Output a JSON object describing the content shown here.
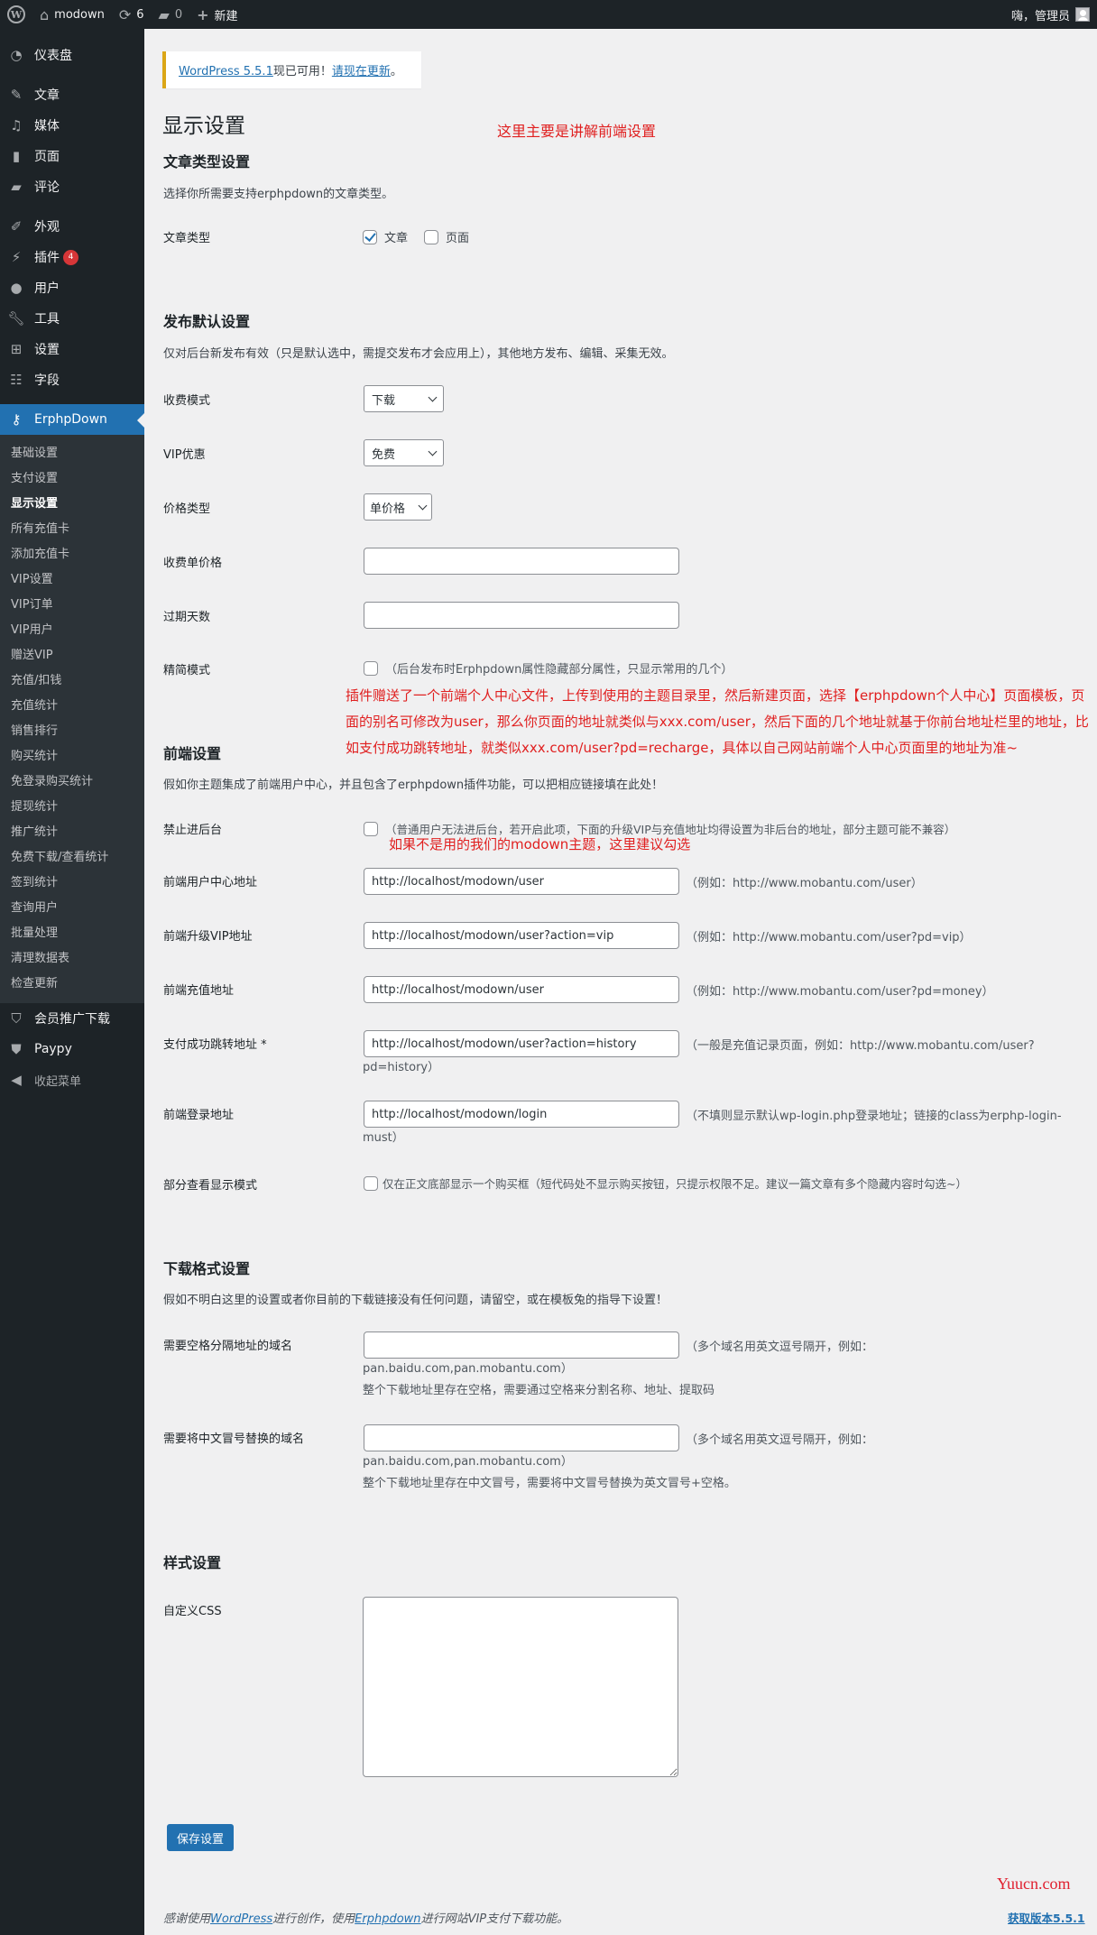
{
  "adminbar": {
    "site_name": "modown",
    "updates_count": "6",
    "comments_count": "0",
    "new_label": "新建",
    "greeting": "嗨，管理员"
  },
  "sidebar": {
    "items": [
      {
        "label": "仪表盘",
        "icon": "dashboard-icon"
      },
      {
        "label": "文章",
        "icon": "pin-icon"
      },
      {
        "label": "媒体",
        "icon": "media-icon"
      },
      {
        "label": "页面",
        "icon": "page-icon"
      },
      {
        "label": "评论",
        "icon": "comment-icon"
      },
      {
        "label": "外观",
        "icon": "brush-icon"
      },
      {
        "label": "插件",
        "icon": "plugin-icon",
        "badge": "4"
      },
      {
        "label": "用户",
        "icon": "user-icon"
      },
      {
        "label": "工具",
        "icon": "wrench-icon"
      },
      {
        "label": "设置",
        "icon": "settings-icon"
      },
      {
        "label": "字段",
        "icon": "fields-icon"
      },
      {
        "label": "ErphpDown",
        "icon": "key-icon"
      }
    ],
    "submenu": [
      "基础设置",
      "支付设置",
      "显示设置",
      "所有充值卡",
      "添加充值卡",
      "VIP设置",
      "VIP订单",
      "VIP用户",
      "赠送VIP",
      "充值/扣钱",
      "充值统计",
      "销售排行",
      "购买统计",
      "免登录购买统计",
      "提现统计",
      "推广统计",
      "免费下载/查看统计",
      "签到统计",
      "查询用户",
      "批量处理",
      "清理数据表",
      "检查更新"
    ],
    "submenu_current": "显示设置",
    "after": [
      {
        "label": "会员推广下载",
        "icon": "shield-half-icon"
      },
      {
        "label": "Paypy",
        "icon": "shield-icon"
      },
      {
        "label": "收起菜单",
        "icon": "collapse-icon"
      }
    ]
  },
  "notice": {
    "link_version": "WordPress 5.5.1",
    "text": "现已可用！",
    "link_update": "请现在更新",
    "end": "。"
  },
  "page_title": "显示设置",
  "annotations": {
    "top": "这里主要是讲解前端设置",
    "middle": "插件赠送了一个前端个人中心文件，上传到使用的主题目录里，然后新建页面，选择【erphpdown个人中心】页面模板，页面的别名可修改为user，那么你页面的地址就类似与xxx.com/user，然后下面的几个地址就基于你前台地址栏里的地址，比如支付成功跳转地址，就类似xxx.com/user?pd=recharge，具体以自己网站前端个人中心页面里的地址为准~",
    "backend": "如果不是用的我们的modown主题，这里建议勾选"
  },
  "post_types": {
    "heading": "文章类型设置",
    "description": "选择你所需要支持erphpdown的文章类型。",
    "label": "文章类型",
    "options": [
      {
        "label": "文章",
        "checked": true
      },
      {
        "label": "页面",
        "checked": false
      }
    ]
  },
  "publish_defaults": {
    "heading": "发布默认设置",
    "description": "仅对后台新发布有效（只是默认选中，需提交发布才会应用上），其他地方发布、编辑、采集无效。",
    "fee_mode": {
      "label": "收费模式",
      "value": "下载"
    },
    "vip_discount": {
      "label": "VIP优惠",
      "value": "免费"
    },
    "price_type": {
      "label": "价格类型",
      "value": "单价格"
    },
    "unit_price": {
      "label": "收费单价格",
      "value": ""
    },
    "expire_days": {
      "label": "过期天数",
      "value": ""
    },
    "simple_mode": {
      "label": "精简模式",
      "checked": false,
      "hint": "（后台发布时Erphpdown属性隐藏部分属性，只显示常用的几个）"
    }
  },
  "frontend": {
    "heading": "前端设置",
    "description": "假如你主题集成了前端用户中心，并且包含了erphpdown插件功能，可以把相应链接填在此处！",
    "no_backend": {
      "label": "禁止进后台",
      "checked": false,
      "hint": "（普通用户无法进后台，若开启此项，下面的升级VIP与充值地址均得设置为非后台的地址，部分主题可能不兼容）"
    },
    "user_center": {
      "label": "前端用户中心地址",
      "value": "http://localhost/modown/user",
      "hint": "（例如：http://www.mobantu.com/user）"
    },
    "vip_upgrade": {
      "label": "前端升级VIP地址",
      "value": "http://localhost/modown/user?action=vip",
      "hint": "（例如：http://www.mobantu.com/user?pd=vip）"
    },
    "recharge": {
      "label": "前端充值地址",
      "value": "http://localhost/modown/user",
      "hint": "（例如：http://www.mobantu.com/user?pd=money）"
    },
    "pay_success": {
      "label": "支付成功跳转地址 *",
      "value": "http://localhost/modown/user?action=history",
      "hint": "（一般是充值记录页面，例如：http://www.mobantu.com/user?",
      "hint2": "pd=history）"
    },
    "login": {
      "label": "前端登录地址",
      "value": "http://localhost/modown/login",
      "hint": "（不填则显示默认wp-login.php登录地址；链接的class为erphp-login-",
      "hint2": "must）"
    },
    "partial_view": {
      "label": "部分查看显示模式",
      "checked": false,
      "hint": "仅在正文底部显示一个购买框（短代码处不显示购买按钮，只提示权限不足。建议一篇文章有多个隐藏内容时勾选~）"
    }
  },
  "download_format": {
    "heading": "下载格式设置",
    "description": "假如不明白这里的设置或者你目前的下载链接没有任何问题，请留空，或在模板兔的指导下设置！",
    "space_domains": {
      "label": "需要空格分隔地址的域名",
      "value": "",
      "hint": "（多个域名用英文逗号隔开，例如：",
      "hint2": "pan.baidu.com,pan.mobantu.com）",
      "note": "整个下载地址里存在空格，需要通过空格来分割名称、地址、提取码"
    },
    "colon_domains": {
      "label": "需要将中文冒号替换的域名",
      "value": "",
      "hint": "（多个域名用英文逗号隔开，例如：",
      "hint2": "pan.baidu.com,pan.mobantu.com）",
      "note": "整个下载地址里存在中文冒号，需要将中文冒号替换为英文冒号+空格。"
    }
  },
  "style": {
    "heading": "样式设置",
    "custom_css": {
      "label": "自定义CSS",
      "value": ""
    }
  },
  "save_label": "保存设置",
  "footer": {
    "pre": "感谢使用",
    "wp_link": "WordPress",
    "mid": "进行创作，使用",
    "erphp_link": "Erphpdown",
    "post": "进行网站VIP支付下载功能。",
    "version_link": "获取版本5.5.1"
  },
  "watermark": "Yuucn.com"
}
